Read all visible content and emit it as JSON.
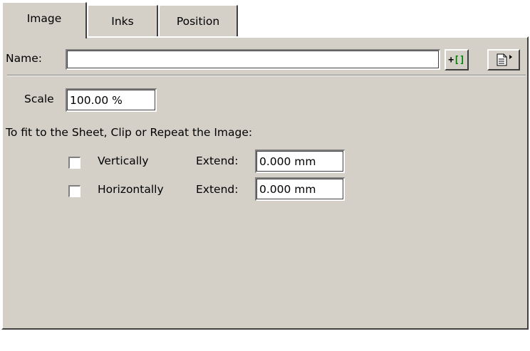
{
  "tabs": [
    {
      "label": "Image",
      "active": true
    },
    {
      "label": "Inks",
      "active": false
    },
    {
      "label": "Position",
      "active": false
    }
  ],
  "name_row": {
    "label": "Name:",
    "value": ""
  },
  "scale": {
    "label": "Scale",
    "value": "100.00 %"
  },
  "fit": {
    "heading": "To fit to the Sheet, Clip or Repeat the Image:",
    "vertical": {
      "label": "Vertically",
      "checked": false,
      "extend_label": "Extend:",
      "extend_value": "0.000 mm"
    },
    "horizontal": {
      "label": "Horizontally",
      "checked": false,
      "extend_label": "Extend:",
      "extend_value": "0.000 mm"
    }
  },
  "colors": {
    "face": "#d4d0c8",
    "bracket_green": "#008000"
  }
}
